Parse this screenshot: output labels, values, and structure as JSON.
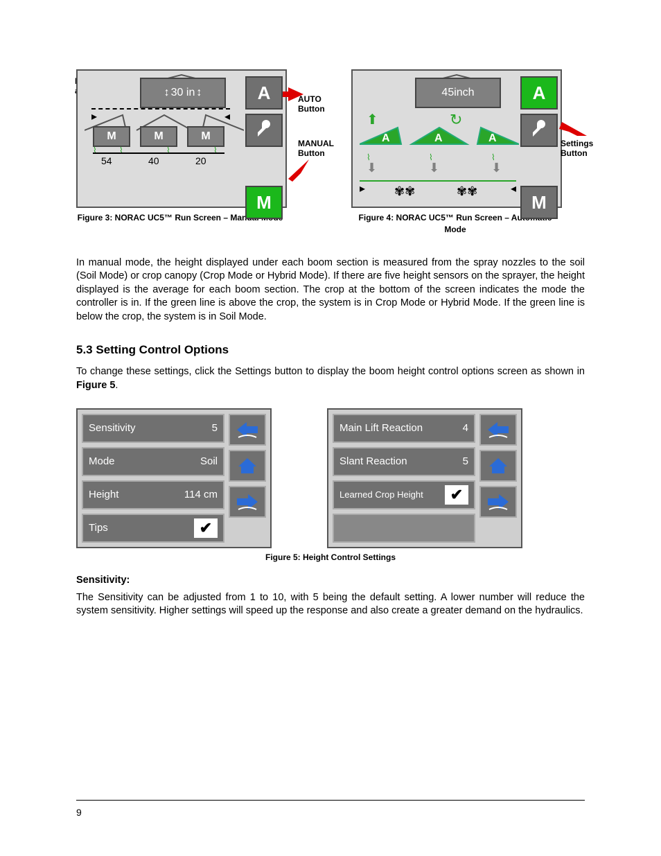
{
  "figures": {
    "fig3": {
      "annot_boom_label": "Boom Height\nand State",
      "annot_auto": "AUTO\nButton",
      "annot_manual": "MANUAL\nButton",
      "topbox_value": "30 in",
      "sections": [
        {
          "mode": "M",
          "height": "54"
        },
        {
          "mode": "M",
          "height": "40"
        },
        {
          "mode": "M",
          "height": "20"
        }
      ],
      "side_auto": "A",
      "side_manual": "M",
      "caption": "Figure 3: NORAC UC5™ Run Screen – Manual Mode"
    },
    "fig4": {
      "annot_settings": "Settings\nButton",
      "topbox_value": "45inch",
      "sections": [
        {
          "mode": "A"
        },
        {
          "mode": "A"
        },
        {
          "mode": "A"
        }
      ],
      "side_auto": "A",
      "side_manual": "M",
      "caption": "Figure 4: NORAC UC5™ Run Screen – Automatic Mode"
    },
    "fig5": {
      "caption": "Figure 5:  Height Control Settings"
    }
  },
  "paragraphs": {
    "p1": "In manual mode, the height displayed under each boom section is measured from the spray nozzles to the soil (Soil Mode) or crop canopy (Crop Mode or Hybrid Mode).  If there are five height sensors on the sprayer, the height displayed is the average for each boom section.  The crop at the bottom of the screen indicates the mode the controller is in.  If the green line is above the crop, the system is in Crop Mode or Hybrid Mode.  If the green line is below the crop, the system is in Soil Mode.",
    "p2": "To change these settings, click the Settings button to display the boom height control options screen as shown in Figure 5.",
    "p3": "The Sensitivity can be adjusted from 1 to 10, with 5 being the default setting.  A lower number will reduce the system sensitivity.  Higher settings will speed up the response and also create a greater demand on the hydraulics."
  },
  "headings": {
    "sec53": "5.3  Setting Control Options",
    "sensitivity": "Sensitivity:"
  },
  "settings_left": [
    {
      "label": "Sensitivity",
      "value": "5"
    },
    {
      "label": "Mode",
      "value": "Soil"
    },
    {
      "label": "Height",
      "value": "114 cm"
    },
    {
      "label": "Tips",
      "value": "check"
    }
  ],
  "settings_right": [
    {
      "label": "Main Lift Reaction",
      "value": "4"
    },
    {
      "label": "Slant Reaction",
      "value": "5"
    },
    {
      "label": "Learned Crop Height",
      "value": "check"
    },
    {
      "label": "",
      "value": ""
    }
  ],
  "page_number": "9"
}
